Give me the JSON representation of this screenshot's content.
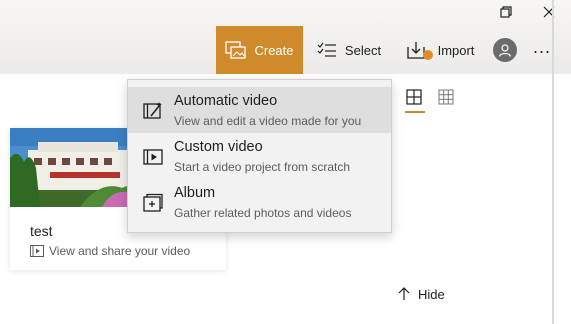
{
  "toolbar": {
    "create_label": "Create",
    "select_label": "Select",
    "import_label": "Import",
    "more_label": "...",
    "accent_color": "#cf8a2c"
  },
  "window_controls": [
    "restore-icon",
    "close-icon"
  ],
  "create_menu": {
    "items": [
      {
        "title": "Automatic video",
        "description": "View and edit a video made for you",
        "icon": "auto-video-icon",
        "highlighted": true
      },
      {
        "title": "Custom video",
        "description": "Start a video project from scratch",
        "icon": "custom-video-icon",
        "highlighted": false
      },
      {
        "title": "Album",
        "description": "Gather related photos and videos",
        "icon": "album-icon",
        "highlighted": false
      }
    ]
  },
  "project_card": {
    "title": "test",
    "subtitle": "View and share your video",
    "thumbnail_icon": "hotel-photo-thumbnail"
  },
  "view_options": [
    "large-grid-icon",
    "small-grid-icon"
  ],
  "hide_label": "Hide"
}
